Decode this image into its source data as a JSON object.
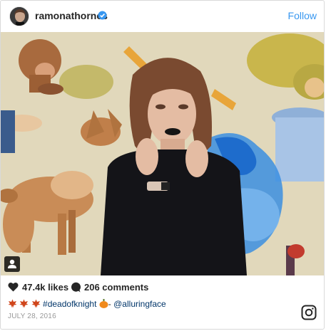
{
  "post": {
    "username": "ramonathornes",
    "follow_label": "Follow",
    "likes": "47.4k likes",
    "comments": "206 comments",
    "caption_tag": "#deadofknight",
    "caption_mention": "@alluringface",
    "caption_separator": "-",
    "date": "JULY 28, 2016"
  },
  "icons": {
    "verified": "verified-badge-icon",
    "heart": "heart-icon",
    "comment": "comment-icon",
    "user_tag": "user-tag-icon",
    "instagram": "instagram-logo-icon",
    "leaf": "maple-leaf-emoji",
    "pumpkin": "jack-o-lantern-emoji"
  },
  "colors": {
    "accent": "#3897f0",
    "text": "#262626",
    "muted": "#999999",
    "hashtag": "#003569"
  }
}
